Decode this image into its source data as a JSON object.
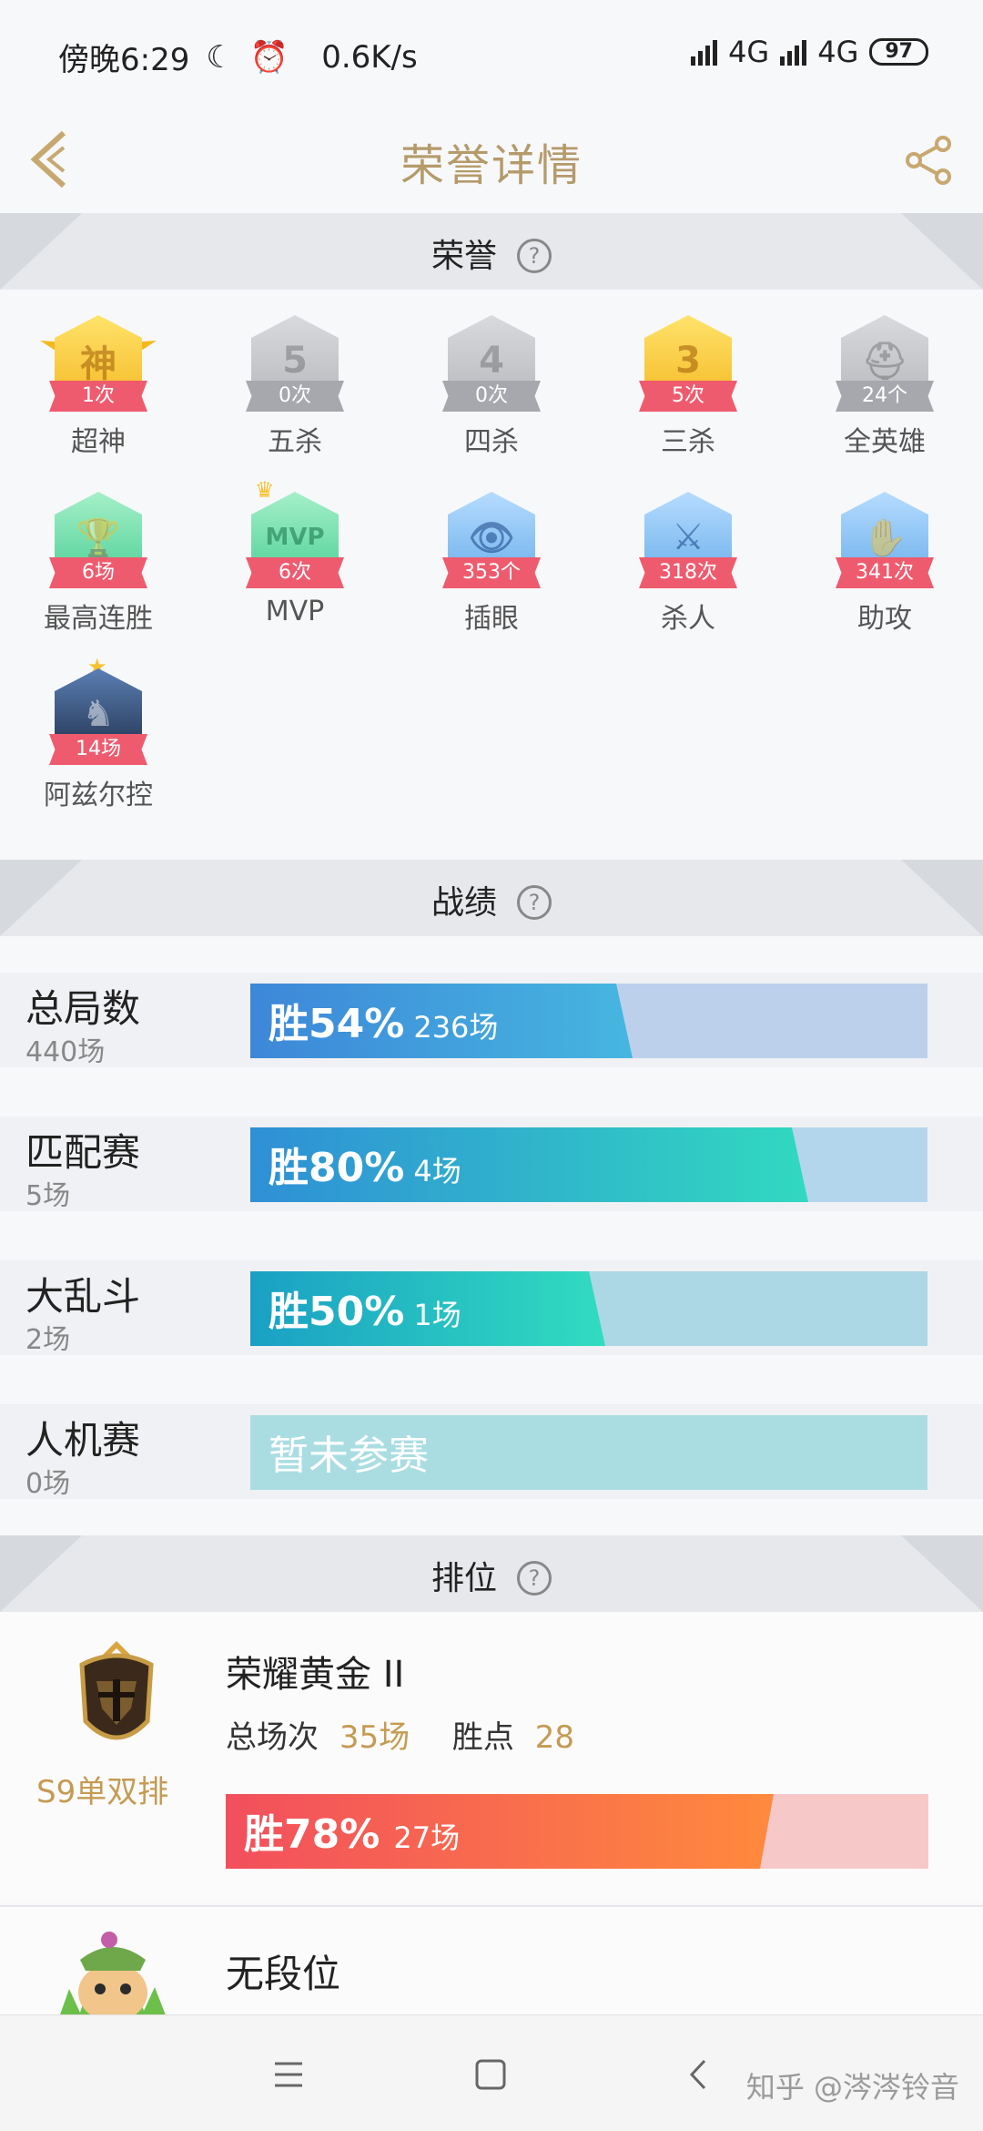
{
  "status_bar": {
    "time": "傍晚6:29",
    "speed": "0.6K/s",
    "net1": "4G",
    "net2": "4G",
    "battery": "97"
  },
  "header": {
    "title": "荣誉详情"
  },
  "sections": {
    "honor": "荣誉",
    "record": "战绩",
    "rank": "排位"
  },
  "honors": [
    {
      "glyph": "神",
      "count": "1次",
      "label": "超神",
      "style": "gold",
      "ribbon": "red"
    },
    {
      "glyph": "5",
      "count": "0次",
      "label": "五杀",
      "style": "silver",
      "ribbon": "gray"
    },
    {
      "glyph": "4",
      "count": "0次",
      "label": "四杀",
      "style": "silver",
      "ribbon": "gray"
    },
    {
      "glyph": "3",
      "count": "5次",
      "label": "三杀",
      "style": "gold",
      "ribbon": "red"
    },
    {
      "glyph": "⛑",
      "count": "24个",
      "label": "全英雄",
      "style": "silver",
      "ribbon": "gray"
    },
    {
      "glyph": "🏆",
      "count": "6场",
      "label": "最高连胜",
      "style": "green",
      "ribbon": "red"
    },
    {
      "glyph": "MVP",
      "count": "6次",
      "label": "MVP",
      "style": "green",
      "ribbon": "red"
    },
    {
      "glyph": "👁",
      "count": "353个",
      "label": "插眼",
      "style": "blue",
      "ribbon": "red"
    },
    {
      "glyph": "⚔",
      "count": "318次",
      "label": "杀人",
      "style": "blue",
      "ribbon": "red"
    },
    {
      "glyph": "✋",
      "count": "341次",
      "label": "助攻",
      "style": "blue",
      "ribbon": "red"
    },
    {
      "glyph": "♞",
      "count": "14场",
      "label": "阿兹尔控",
      "style": "portrait",
      "ribbon": "red"
    }
  ],
  "records": [
    {
      "name": "总局数",
      "count": "440场",
      "win_pct": "胜54%",
      "win_games": "236场",
      "win_rate": 0.54,
      "fill_from": "#3d87d8",
      "fill_to": "#46b6e0",
      "track": "#bcd0ec"
    },
    {
      "name": "匹配赛",
      "count": "5场",
      "win_pct": "胜80%",
      "win_games": "4场",
      "win_rate": 0.8,
      "fill_from": "#2f8fd6",
      "fill_to": "#31d9c0",
      "track": "#b4d6ec"
    },
    {
      "name": "大乱斗",
      "count": "2场",
      "win_pct": "胜50%",
      "win_games": "1场",
      "win_rate": 0.5,
      "fill_from": "#1aa0c4",
      "fill_to": "#31dcc0",
      "track": "#acd7e4"
    },
    {
      "name": "人机赛",
      "count": "0场",
      "none_text": "暂未参赛",
      "win_rate": 0,
      "track": "#a9dde2"
    }
  ],
  "ranked": {
    "season": "S9单双排",
    "tier": "荣耀黄金 II",
    "total_label": "总场次",
    "total_value": "35场",
    "points_label": "胜点",
    "points_value": "28",
    "win_pct": "胜78%",
    "win_games": "27场",
    "win_rate": 0.78
  },
  "unranked": {
    "label": "无段位"
  },
  "watermark": "知乎 @涔涔铃音"
}
